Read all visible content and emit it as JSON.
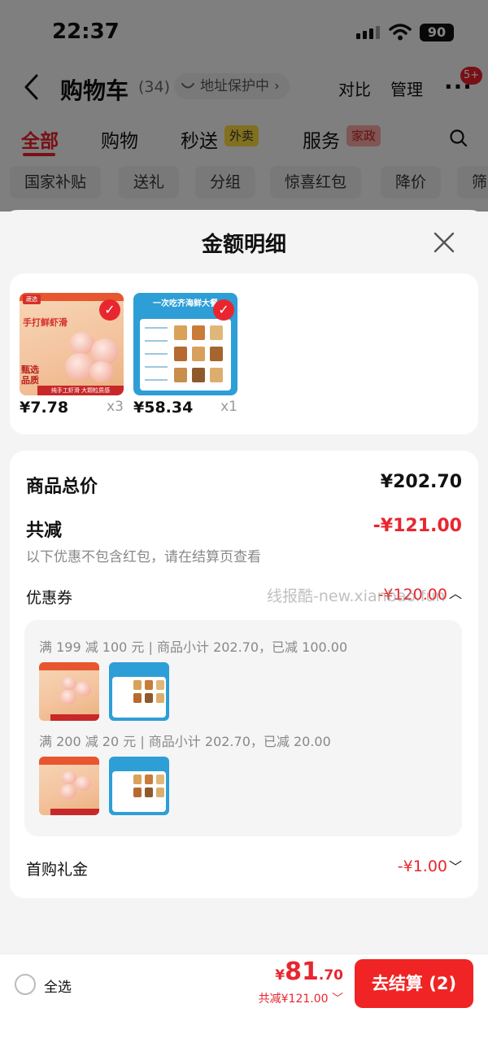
{
  "status_bar": {
    "time": "22:37",
    "battery": "90"
  },
  "header": {
    "title": "购物车",
    "count": "(34)",
    "address_protect": "地址保护中",
    "compare": "对比",
    "manage": "管理",
    "more_badge": "5+"
  },
  "tabs": [
    {
      "label": "全部"
    },
    {
      "label": "购物"
    },
    {
      "label": "秒送",
      "tag": "外卖"
    },
    {
      "label": "服务",
      "tag": "家政"
    }
  ],
  "chips": [
    "国家补贴",
    "送礼",
    "分组",
    "惊喜红包",
    "降价",
    "筛"
  ],
  "sheet": {
    "title": "金额明细",
    "products": [
      {
        "price": "¥7.78",
        "qty": "x3",
        "thumb_heading": "手打鲜虾滑",
        "thumb_logo": "蔬选",
        "thumb_stamp": "甄选\n品质",
        "thumb_banner": "纯手工虾滑 大颗粒质感"
      },
      {
        "price": "¥58.34",
        "qty": "x1",
        "thumb_heading": "一次吃齐海鲜大餐"
      }
    ],
    "total_label": "商品总价",
    "total_value": "¥202.70",
    "reduce_label": "共减",
    "reduce_value": "-¥121.00",
    "note": "以下优惠不包含红包，请在结算页查看",
    "coupon_label": "优惠券",
    "coupon_value": "-¥120.00",
    "coupon_lines": [
      "满 199 减 100 元 | 商品小计 202.70，已减 100.00",
      "满 200 减 20 元 | 商品小计 202.70，已减 20.00"
    ],
    "first_gift_label": "首购礼金",
    "first_gift_value": "-¥1.00"
  },
  "watermark": "线报酷-new.xianbao.fun",
  "bottom": {
    "select_all": "全选",
    "currency": "¥",
    "price_int": "81",
    "price_dec": ".70",
    "discount": "共减¥121.00",
    "checkout": "去结算 (2)"
  },
  "colors": {
    "accent": "#e8262f",
    "checkout": "#f02424"
  }
}
